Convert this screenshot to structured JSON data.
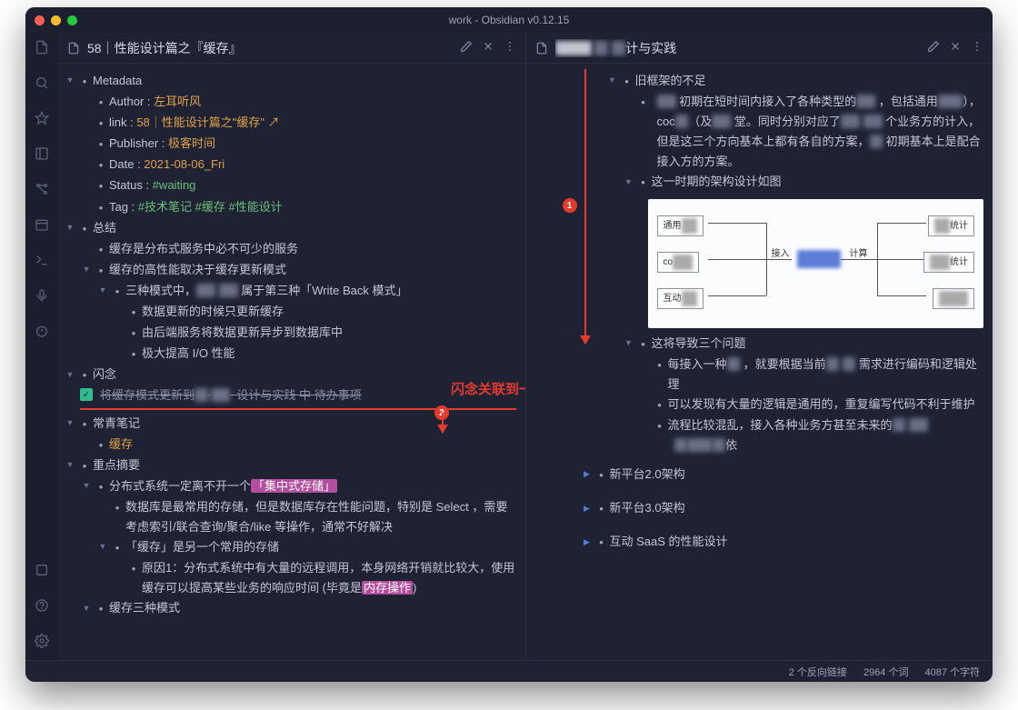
{
  "window_title": "work - Obsidian v0.12.15",
  "left": {
    "title": "58｜性能设计篇之『缓存』",
    "metadata": {
      "heading": "Metadata",
      "author_label": "Author : ",
      "author": "左耳听风",
      "link_label": "link : ",
      "link_text": "58｜性能设计篇之\"缓存\"",
      "publisher_label": "Publisher : ",
      "publisher": "极客时间",
      "date_label": "Date : ",
      "date": "2021-08-06_Fri",
      "status_label": "Status :  ",
      "status": "#waiting",
      "tag_label": "Tag : ",
      "tags": [
        "#技术笔记",
        "#缓存",
        "#性能设计"
      ]
    },
    "summary": {
      "heading": "总结",
      "b1": "缓存是分布式服务中必不可少的服务",
      "b2": "缓存的高性能取决于缓存更新模式",
      "b3a": "三种模式中，",
      "b3b": "属于第三种「Write Back 模式」",
      "b4": "数据更新的时候只更新缓存",
      "b5": "由后端服务将数据更新异步到数据库中",
      "b6": "极大提高 I/O 性能"
    },
    "flash": {
      "heading": "闪念",
      "task_a": "将缓存模式更新到",
      "task_b": "设计与实践",
      "task_c": "待办事项"
    },
    "evergreen": {
      "heading": "常青笔记",
      "link": "缓存"
    },
    "excerpt": {
      "heading": "重点摘要",
      "l1a": "分布式系统一定离不开一个",
      "l1b": "「集中式存储」",
      "l2": "数据库是最常用的存储，但是数据库存在性能问题，特别是 Select ，需要考虑索引/联合查询/聚合/like 等操作，通常不好解决",
      "l3": "「缓存」是另一个常用的存储",
      "l4a": "原因1：分布式系统中有大量的远程调用，本身网络开销就比较大，使用缓存可以提高某些业务的响应时间  (毕竟是",
      "l4b": "内存操作",
      "l4c": ")",
      "l5": "缓存三种模式"
    }
  },
  "right": {
    "title_suffix": "计与实践",
    "sec1": {
      "heading": "旧框架的不足",
      "p1a": "初期在短时间内接入了各种类型的",
      "p1b": "，包括通用",
      "p1c": "），coc",
      "p1d": "（及",
      "p1e": "堂。同时分别对应了",
      "p1f": "个业务方的计入，但是这三个方向基本上都有各自的方案，",
      "p1g": "初期基本上是配合接入方的方案。",
      "p2": "这一时期的架构设计如图",
      "p3": "这将导致三个问题",
      "q1a": "每接入一种",
      "q1b": "，就要根据当前",
      "q1c": "需求进行编码和逻辑处理",
      "q2": "可以发现有大量的逻辑是通用的，重复编写代码不利于维护",
      "q3a": "流程比较混乱，接入各种业务方甚至未来的",
      "q3b": "依"
    },
    "sec2": "新平台2.0架构",
    "sec3": "新平台3.0架构",
    "sec4": "互动 SaaS 的性能设计"
  },
  "diagram": {
    "left1": "通用",
    "left2": "co",
    "left3": "互动",
    "mid1": "接入",
    "mid2": "计算",
    "right1": "统计",
    "right2": "统计"
  },
  "annotation": {
    "text": "闪念关联到一篇笔记以及任务",
    "b1": "1",
    "b2": "2"
  },
  "status": {
    "backlinks": "2 个反向链接",
    "words": "2964 个词",
    "chars": "4087 个字符"
  }
}
